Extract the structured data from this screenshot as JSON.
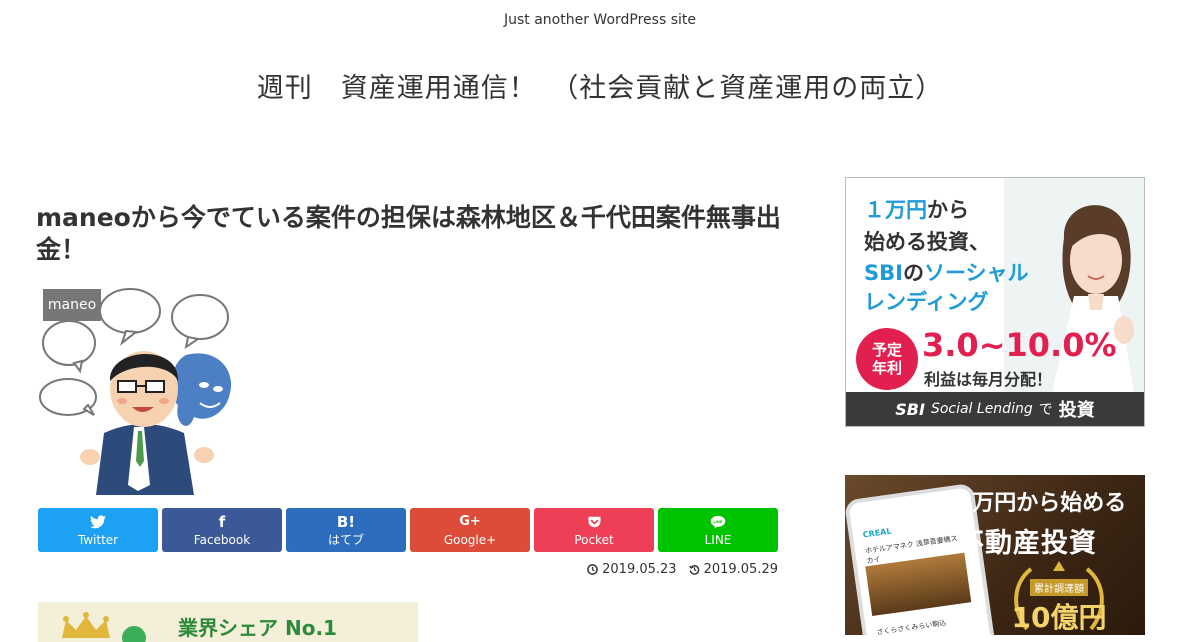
{
  "site": {
    "tagline": "Just another WordPress site",
    "title": "週刊　資産運用通信！　（社会貢献と資産運用の両立）"
  },
  "post": {
    "title": "maneoから今でている案件の担保は森林地区＆千代田案件無事出金！",
    "category": "maneo",
    "published": "2019.05.23",
    "updated": "2019.05.29"
  },
  "share_buttons": [
    {
      "label": "Twitter",
      "icon": "twitter-icon",
      "color": "#1da1f2"
    },
    {
      "label": "Facebook",
      "icon": "facebook-icon",
      "color": "#3b5998"
    },
    {
      "label": "はてブ",
      "icon": "hatena-icon",
      "color": "#2c6ebd"
    },
    {
      "label": "Google+",
      "icon": "google-plus-icon",
      "color": "#dd4b39"
    },
    {
      "label": "Pocket",
      "icon": "pocket-icon",
      "color": "#ef3f56"
    },
    {
      "label": "LINE",
      "icon": "line-icon",
      "color": "#00c300"
    }
  ],
  "sidebar": {
    "ad1": {
      "line1_accent": "１万円",
      "line1_rest": "から",
      "line2": "始める投資、",
      "line3_accent1": "SBI",
      "line3_mid": "の",
      "line3_accent2": "ソーシャル",
      "line4": "レンディング",
      "rate_badge_1": "予定",
      "rate_badge_2": "年利",
      "rate_value": "3.0~10.0%",
      "sub": "利益は毎月分配！",
      "footer_brand": "SBI",
      "footer_text": "Social Lending",
      "footer_de": "で",
      "footer_big": "投資"
    },
    "ad2": {
      "headline1": "1万円から始める",
      "headline2": "不動産投資",
      "phone_brand": "CREAL",
      "phone_title": "ホテルアマネク 浅草吾妻橋スカイ",
      "phone_footer": "さくらさくみらい駒込",
      "medal_label": "累計調達額",
      "medal_value": "10億円"
    }
  },
  "bottom_banner": {
    "text": "業界シェア No.1"
  },
  "colors": {
    "twitter": "#1da1f2",
    "facebook": "#3b5998",
    "hatena": "#2c6ebd",
    "google_plus": "#dd4b39",
    "pocket": "#ef3f56",
    "line": "#00c300",
    "category_bg": "#777777",
    "sbi_accent": "#1f9bd7",
    "rate_pink": "#e2204f"
  }
}
